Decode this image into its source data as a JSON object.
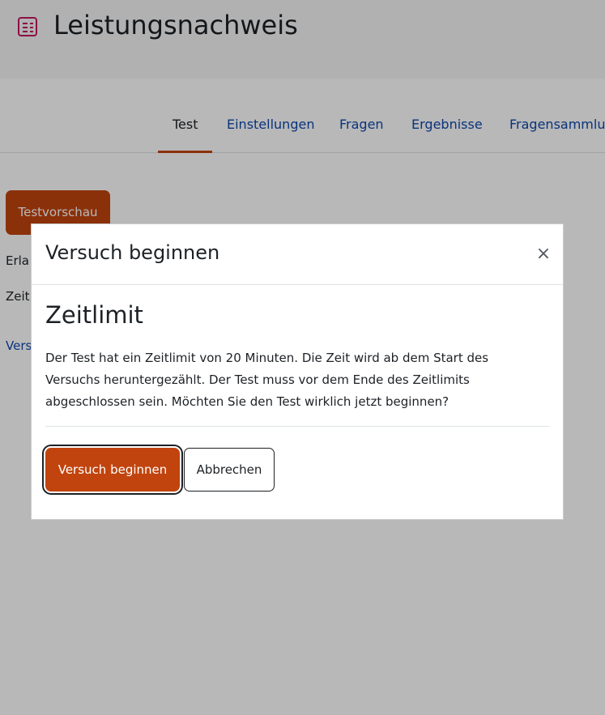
{
  "page": {
    "title": "Leistungsnachweis",
    "icon": "quiz-icon"
  },
  "tabs": [
    {
      "label": "Test",
      "active": true
    },
    {
      "label": "Einstellungen",
      "active": false
    },
    {
      "label": "Fragen",
      "active": false
    },
    {
      "label": "Ergebnisse",
      "active": false
    },
    {
      "label": "Fragensammlung",
      "active": false
    }
  ],
  "background": {
    "preview_button": "Testvorschau",
    "line1": "Erla",
    "line2": "Zeit",
    "link": "Vers"
  },
  "modal": {
    "title": "Versuch beginnen",
    "heading": "Zeitlimit",
    "body": "Der Test hat ein Zeitlimit von 20 Minuten. Die Zeit wird ab dem Start des Versuchs heruntergezählt. Der Test muss vor dem Ende des Zeitlimits abgeschlossen sein. Möchten Sie den Test wirklich jetzt beginnen?",
    "primary_button": "Versuch beginnen",
    "secondary_button": "Abbrechen",
    "close_icon": "close-icon"
  },
  "colors": {
    "accent": "#c1440e",
    "link": "#0f47ad",
    "icon": "#c2185b"
  }
}
